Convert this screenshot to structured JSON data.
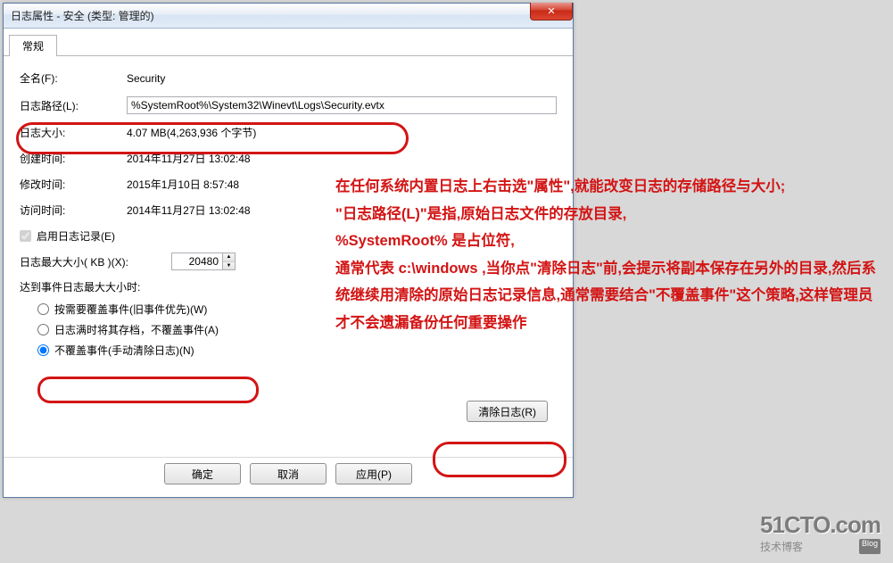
{
  "window": {
    "title": "日志属性 - 安全 (类型: 管理的)",
    "closeGlyph": "✕"
  },
  "tabs": {
    "general": "常规"
  },
  "fields": {
    "fullName_lbl": "全名(F):",
    "fullName_val": "Security",
    "logPath_lbl": "日志路径(L):",
    "logPath_val": "%SystemRoot%\\System32\\Winevt\\Logs\\Security.evtx",
    "logSize_lbl": "日志大小:",
    "logSize_val": "4.07 MB(4,263,936 个字节)",
    "created_lbl": "创建时间:",
    "created_val": "2014年11月27日 13:02:48",
    "modified_lbl": "修改时间:",
    "modified_val": "2015年1月10日 8:57:48",
    "accessed_lbl": "访问时间:",
    "accessed_val": "2014年11月27日 13:02:48"
  },
  "enableLogging": "启用日志记录(E)",
  "maxSize_lbl": "日志最大大小( KB )(X):",
  "maxSize_val": "20480",
  "maxReached_lbl": "达到事件日志最大大小时:",
  "radios": {
    "r1": "按需要覆盖事件(旧事件优先)(W)",
    "r2": "日志满时将其存档，不覆盖事件(A)",
    "r3": "不覆盖事件(手动清除日志)(N)"
  },
  "buttons": {
    "clear": "清除日志(R)",
    "ok": "确定",
    "cancel": "取消",
    "apply": "应用(P)"
  },
  "annotation": "在任何系统内置日志上右击选\"属性\",就能改变日志的存储路径与大小;\n\"日志路径(L)\"是指,原始日志文件的存放目录,\n%SystemRoot% 是占位符,\n通常代表 c:\\windows ,当你点\"清除日志\"前,会提示将副本保存在另外的目录,然后系统继续用清除的原始日志记录信息,通常需要结合\"不覆盖事件\"这个策略,这样管理员才不会遗漏备份任何重要操作",
  "watermark": {
    "big": "51CTO.com",
    "small": "技术博客",
    "tag": "Blog"
  }
}
